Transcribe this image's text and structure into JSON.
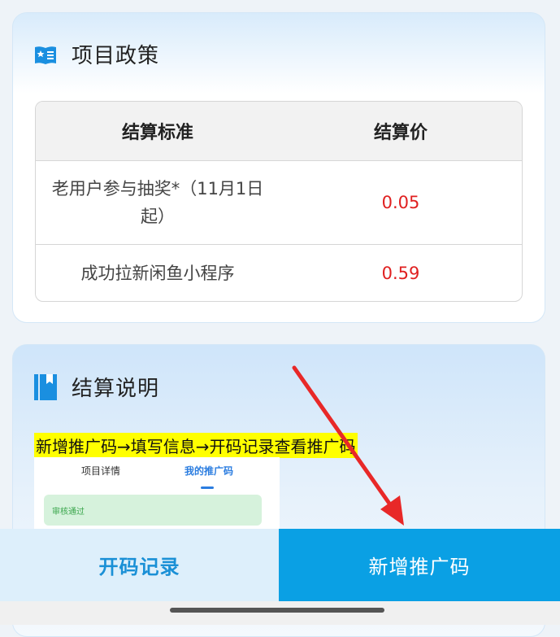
{
  "policy": {
    "title": "项目政策",
    "headers": [
      "结算标准",
      "结算价"
    ],
    "rows": [
      {
        "standard": "老用户参与抽奖*（11月1日起）",
        "price": "0.05"
      },
      {
        "standard": "成功拉新闲鱼小程序",
        "price": "0.59"
      }
    ]
  },
  "settlement": {
    "title": "结算说明",
    "instruction": "新增推广码→填写信息→开码记录查看推广码",
    "preview": {
      "tab_detail": "项目详情",
      "tab_my_codes": "我的推广码",
      "status": "审核通过"
    }
  },
  "bottom": {
    "records_label": "开码记录",
    "new_code_label": "新增推广码"
  },
  "colors": {
    "accent": "#0aa0e4",
    "price_red": "#e02020",
    "highlight": "#ffff00",
    "arrow_red": "#e82828"
  }
}
